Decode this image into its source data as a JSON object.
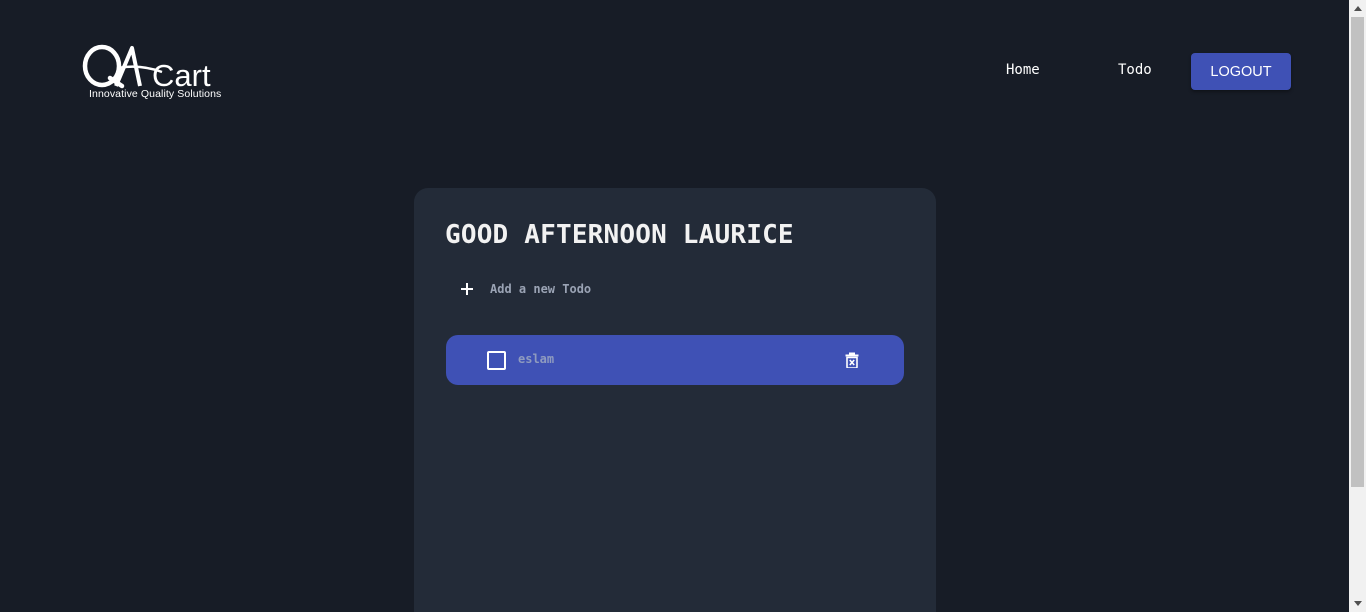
{
  "header": {
    "logo_text": "QACart",
    "logo_tagline": "Innovative Quality Solutions",
    "nav": {
      "home_label": "Home",
      "todo_label": "Todo"
    },
    "logout_label": "LOGOUT"
  },
  "todo_card": {
    "greeting": "GOOD AFTERNOON LAURICE",
    "add_label": "Add a new Todo",
    "add_icon": "plus-icon",
    "items": [
      {
        "text": "eslam",
        "completed": false,
        "delete_icon": "trash-icon"
      }
    ]
  },
  "colors": {
    "page_bg": "#171c26",
    "card_bg": "#232b38",
    "accent": "#3f51b5",
    "muted_text": "#9aa3b4"
  }
}
